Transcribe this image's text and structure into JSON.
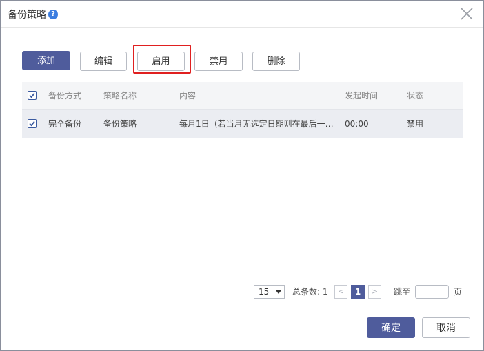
{
  "dialog": {
    "title": "备份策略",
    "help_icon": "question-circle-icon",
    "close_icon": "close-icon"
  },
  "toolbar": {
    "add_label": "添加",
    "edit_label": "编辑",
    "enable_label": "启用",
    "disable_label": "禁用",
    "delete_label": "删除"
  },
  "table": {
    "headers": [
      "备份方式",
      "策略名称",
      "内容",
      "发起时间",
      "状态"
    ],
    "rows": [
      {
        "checked": true,
        "method": "完全备份",
        "name": "备份策略",
        "content": "每月1日（若当月无选定日期则在最后一…",
        "time": "00:00",
        "status": "禁用"
      }
    ]
  },
  "pagination": {
    "page_size": "15",
    "total_label": "总条数: 1",
    "prev": "<",
    "current_page": "1",
    "next": ">",
    "jump_label": "跳至",
    "jump_value": "",
    "page_suffix": "页"
  },
  "footer": {
    "confirm_label": "确定",
    "cancel_label": "取消"
  },
  "colors": {
    "primary": "#4f5c9c",
    "highlight": "#e02020",
    "help": "#3b7de0"
  }
}
